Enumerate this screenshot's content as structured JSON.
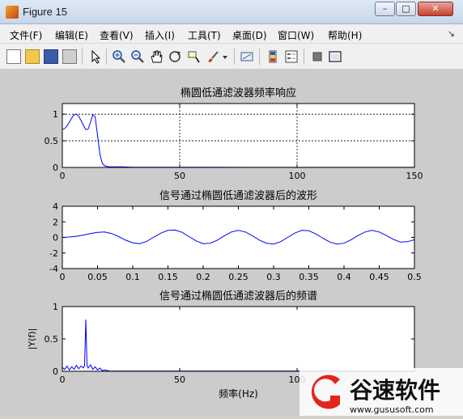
{
  "window": {
    "title": "Figure 15",
    "minimize": "–",
    "maximize": "□",
    "close": "✕"
  },
  "menu": {
    "items": [
      "文件(F)",
      "编辑(E)",
      "查看(V)",
      "插入(I)",
      "工具(T)",
      "桌面(D)",
      "窗口(W)",
      "帮助(H)"
    ],
    "dock_arrow": "↘"
  },
  "toolbar": {
    "icons": [
      "new-file-icon",
      "open-folder-icon",
      "save-icon",
      "print-icon",
      "pointer-icon",
      "zoom-in-icon",
      "zoom-out-icon",
      "pan-hand-icon",
      "rotate-3d-icon",
      "data-cursor-icon",
      "brush-icon",
      "brush-dropdown-icon",
      "link-plot-icon",
      "colorbar-icon",
      "legend-icon",
      "hide-plot-tools-icon",
      "show-plot-tools-icon"
    ]
  },
  "colors": {
    "line": "#0000ff",
    "axes_bg": "#ffffff",
    "figure_bg": "#cccccc",
    "watermark_red": "#e3261c"
  },
  "chart_data": [
    {
      "type": "line",
      "title": "椭圆低通滤波器频率响应",
      "xlabel": "",
      "ylabel": "",
      "xlim": [
        0,
        150
      ],
      "ylim": [
        0,
        1.2
      ],
      "xticks": [
        0,
        50,
        100,
        150
      ],
      "yticks": [
        0,
        0.5,
        1
      ],
      "grid": true,
      "series": [
        {
          "x": [
            0,
            1,
            2,
            3,
            4,
            5,
            6,
            7,
            8,
            9,
            10,
            11,
            12,
            13,
            14,
            15,
            16,
            17,
            18,
            19,
            20,
            25,
            30,
            40,
            60,
            80,
            100,
            120,
            150
          ],
          "y": [
            0.71,
            0.73,
            0.78,
            0.85,
            0.93,
            0.99,
            1.0,
            0.96,
            0.88,
            0.79,
            0.71,
            0.72,
            0.85,
            0.99,
            0.95,
            0.6,
            0.25,
            0.08,
            0.03,
            0.02,
            0.01,
            0.01,
            0.005,
            0.004,
            0.003,
            0.002,
            0.002,
            0.001,
            0.001
          ]
        }
      ]
    },
    {
      "type": "line",
      "title": "信号通过椭圆低通滤波器后的波形",
      "xlabel": "",
      "ylabel": "",
      "xlim": [
        0,
        0.5
      ],
      "ylim": [
        -4,
        4
      ],
      "xticks": [
        0,
        0.05,
        0.1,
        0.15,
        0.2,
        0.25,
        0.3,
        0.35,
        0.4,
        0.45,
        0.5
      ],
      "yticks": [
        -4,
        -2,
        0,
        2,
        4
      ],
      "grid": false,
      "series": [
        {
          "x": [
            0,
            0.01,
            0.02,
            0.03,
            0.04,
            0.05,
            0.06,
            0.07,
            0.08,
            0.09,
            0.1,
            0.11,
            0.12,
            0.13,
            0.14,
            0.15,
            0.16,
            0.17,
            0.18,
            0.19,
            0.2,
            0.21,
            0.22,
            0.23,
            0.24,
            0.25,
            0.26,
            0.27,
            0.28,
            0.29,
            0.3,
            0.31,
            0.32,
            0.33,
            0.34,
            0.35,
            0.36,
            0.37,
            0.38,
            0.39,
            0.4,
            0.41,
            0.42,
            0.43,
            0.44,
            0.45,
            0.46,
            0.47,
            0.48,
            0.49,
            0.5
          ],
          "y": [
            0,
            0.05,
            0.15,
            0.3,
            0.5,
            0.65,
            0.7,
            0.5,
            0.1,
            -0.35,
            -0.7,
            -0.8,
            -0.5,
            0.05,
            0.55,
            0.9,
            0.95,
            0.65,
            0.1,
            -0.45,
            -0.8,
            -0.75,
            -0.35,
            0.2,
            0.7,
            0.9,
            0.7,
            0.2,
            -0.35,
            -0.75,
            -0.85,
            -0.55,
            0.0,
            0.55,
            0.9,
            0.85,
            0.45,
            -0.1,
            -0.6,
            -0.85,
            -0.75,
            -0.3,
            0.25,
            0.7,
            0.9,
            0.7,
            0.25,
            -0.25,
            -0.6,
            -0.55,
            -0.3
          ]
        }
      ]
    },
    {
      "type": "line",
      "title": "信号通过椭圆低通滤波器后的频谱",
      "xlabel": "频率(Hz)",
      "ylabel": "|Y(f)|",
      "xlim": [
        0,
        150
      ],
      "ylim": [
        0,
        1
      ],
      "xticks": [
        0,
        50,
        100
      ],
      "yticks": [
        0,
        0.5,
        1
      ],
      "grid": false,
      "series": [
        {
          "x": [
            0,
            1,
            2,
            3,
            4,
            5,
            6,
            7,
            8,
            9,
            9.5,
            10,
            10.5,
            11,
            12,
            13,
            14,
            15,
            16,
            17,
            18,
            20,
            30,
            50,
            80,
            100,
            150
          ],
          "y": [
            0.06,
            0.03,
            0.08,
            0.02,
            0.07,
            0.03,
            0.09,
            0.04,
            0.08,
            0.05,
            0.09,
            0.8,
            0.09,
            0.05,
            0.1,
            0.03,
            0.07,
            0.02,
            0.05,
            0.01,
            0.02,
            0.005,
            0.004,
            0.003,
            0.002,
            0.002,
            0.001
          ]
        }
      ]
    }
  ],
  "watermark": {
    "brand": "谷速软件",
    "url": "www.gususoft.com"
  }
}
